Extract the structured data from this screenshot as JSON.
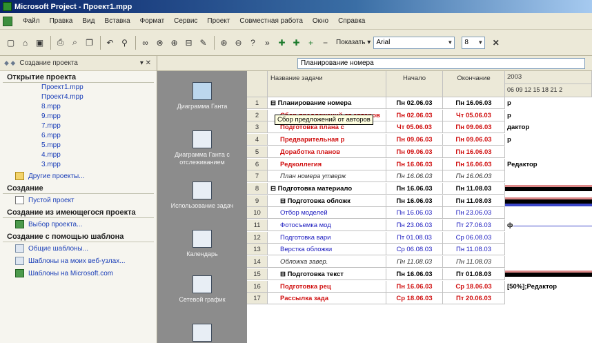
{
  "window": {
    "title": "Microsoft Project - Проект1.mpp"
  },
  "menu": [
    "Файл",
    "Правка",
    "Вид",
    "Вставка",
    "Формат",
    "Сервис",
    "Проект",
    "Совместная работа",
    "Окно",
    "Справка"
  ],
  "toolbar": {
    "show_label": "Показать",
    "font_name": "Arial",
    "font_size": "8"
  },
  "entry_bar": {
    "value": "Планирование номера"
  },
  "taskpane": {
    "title": "Создание проекта",
    "section_open": "Открытие проекта",
    "recent_files": [
      "Проект1.mpp",
      "Проект4.mpp",
      "8.mpp",
      "9.mpp",
      "7.mpp",
      "6.mpp",
      "5.mpp",
      "4.mpp",
      "3.mpp"
    ],
    "more_projects": "Другие проекты...",
    "section_create": "Создание",
    "blank_project": "Пустой проект",
    "section_from_existing": "Создание из имеющегося проекта",
    "choose_project": "Выбор проекта...",
    "section_from_template": "Создание с помощью шаблона",
    "general_templates": "Общие шаблоны...",
    "web_templates": "Шаблоны на моих веб-узлах...",
    "ms_templates": "Шаблоны на Microsoft.com"
  },
  "viewbar": {
    "items": [
      {
        "label": "Диаграмма Ганта",
        "icon": "gantt-chart-icon"
      },
      {
        "label": "Диаграмма Ганта с отслеживанием",
        "icon": "tracking-gantt-icon"
      },
      {
        "label": "Использование задач",
        "icon": "task-usage-icon"
      },
      {
        "label": "Календарь",
        "icon": "calendar-icon"
      },
      {
        "label": "Сетевой график",
        "icon": "network-diagram-icon"
      },
      {
        "label": "",
        "icon": "resource-graph-icon"
      }
    ]
  },
  "grid": {
    "headers": {
      "name": "Название задачи",
      "start": "Начало",
      "finish": "Окончание"
    },
    "timescale": {
      "year": "2003",
      "days": "06 09 12 15 18 21 2"
    },
    "tooltip": "Сбор предложений от авторов",
    "rows": [
      {
        "id": "1",
        "name": "⊟ Планирование номера",
        "start": "Пн 02.06.03",
        "finish": "Пн 16.06.03",
        "style": "bold",
        "gantt": "р"
      },
      {
        "id": "2",
        "name": "Сбор предложений от авторов",
        "start": "Пн 02.06.03",
        "finish": "Чт 05.06.03",
        "style": "red",
        "gantt": "р"
      },
      {
        "id": "3",
        "name": "Подготовка плана с",
        "start": "Чт 05.06.03",
        "finish": "Пн 09.06.03",
        "style": "red",
        "gantt": "дактор"
      },
      {
        "id": "4",
        "name": "Предварительная р",
        "start": "Пн 09.06.03",
        "finish": "Пн 09.06.03",
        "style": "red",
        "gantt": "р"
      },
      {
        "id": "5",
        "name": "Доработка планов",
        "start": "Пн 09.06.03",
        "finish": "Пн 16.06.03",
        "style": "red",
        "gantt": ""
      },
      {
        "id": "6",
        "name": "Редколлегия",
        "start": "Пн 16.06.03",
        "finish": "Пн 16.06.03",
        "style": "red",
        "gantt": "Редактор"
      },
      {
        "id": "7",
        "name": "План номера утверж",
        "start": "Пн 16.06.03",
        "finish": "Пн 16.06.03",
        "style": "ital",
        "gantt": ""
      },
      {
        "id": "8",
        "name": "⊟ Подготовка материало",
        "start": "Пн 16.06.03",
        "finish": "Пн 11.08.03",
        "style": "bold",
        "gantt": ""
      },
      {
        "id": "9",
        "name": "⊟ Подготовка обложк",
        "start": "Пн 16.06.03",
        "finish": "Пн 11.08.03",
        "style": "bold",
        "gantt": ""
      },
      {
        "id": "10",
        "name": "Отбор моделей",
        "start": "Пн 16.06.03",
        "finish": "Пн 23.06.03",
        "style": "blue",
        "gantt": ""
      },
      {
        "id": "11",
        "name": "Фотосъемка мод",
        "start": "Пн 23.06.03",
        "finish": "Пт 27.06.03",
        "style": "blue",
        "gantt": "ф"
      },
      {
        "id": "12",
        "name": "Подготовка вари",
        "start": "Пт 01.08.03",
        "finish": "Ср 06.08.03",
        "style": "blue",
        "gantt": ""
      },
      {
        "id": "13",
        "name": "Верстка обложки",
        "start": "Ср 06.08.03",
        "finish": "Пн 11.08.03",
        "style": "blue",
        "gantt": ""
      },
      {
        "id": "14",
        "name": "Обложка завер.",
        "start": "Пн 11.08.03",
        "finish": "Пн 11.08.03",
        "style": "ital",
        "gantt": ""
      },
      {
        "id": "15",
        "name": "⊟ Подготовка текст",
        "start": "Пн 16.06.03",
        "finish": "Пт 01.08.03",
        "style": "bold",
        "gantt": ""
      },
      {
        "id": "16",
        "name": "Подготовка рец",
        "start": "Пн 16.06.03",
        "finish": "Ср 18.06.03",
        "style": "red",
        "gantt": "[50%];Редактор"
      },
      {
        "id": "17",
        "name": "Рассылка зада",
        "start": "Ср 18.06.03",
        "finish": "Пт 20.06.03",
        "style": "red",
        "gantt": ""
      }
    ]
  }
}
